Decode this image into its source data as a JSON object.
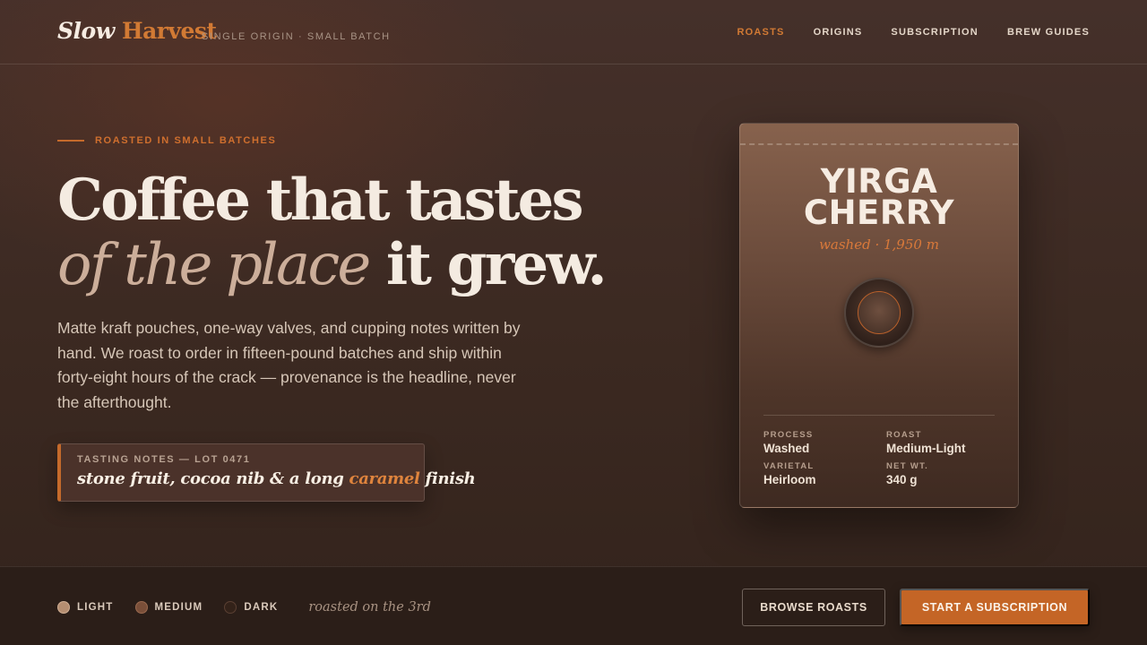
{
  "brand": {
    "word1": "Slow",
    "word2": "Harvest",
    "tagline": "SINGLE ORIGIN · SMALL BATCH"
  },
  "nav": {
    "items": [
      {
        "label": "ROASTS",
        "active": true
      },
      {
        "label": "ORIGINS",
        "active": false
      },
      {
        "label": "SUBSCRIPTION",
        "active": false
      },
      {
        "label": "BREW GUIDES",
        "active": false
      }
    ]
  },
  "hero": {
    "eyebrow": "ROASTED IN SMALL BATCHES",
    "headline": {
      "part1": "Coffee that tastes ",
      "part2_italic": "of the place",
      "part3": " it grew."
    },
    "intro": "Matte kraft pouches, one-way valves, and cupping notes written by hand. We roast to order in fifteen-pound batches and ship within forty-eight hours of the crack — provenance is the headline, never the afterthought.",
    "tasting": {
      "label": "TASTING NOTES — LOT 0471",
      "note_before": "stone fruit, cocoa nib & a long ",
      "note_highlight": "caramel",
      "note_after": " finish"
    }
  },
  "bag": {
    "name_line1": "YIRGA",
    "name_line2": "CHERRY",
    "subtitle": "washed · 1,950 m",
    "specs": [
      {
        "label": "PROCESS",
        "value": "Washed"
      },
      {
        "label": "ROAST",
        "value": "Medium-Light"
      },
      {
        "label": "VARIETAL",
        "value": "Heirloom"
      },
      {
        "label": "NET WT.",
        "value": "340 g"
      }
    ]
  },
  "footer": {
    "roast_levels": [
      {
        "label": "LIGHT",
        "color": "#b58e71"
      },
      {
        "label": "MEDIUM",
        "color": "#7a4f39"
      },
      {
        "label": "DARK",
        "color": "#332219"
      }
    ],
    "roast_date": "roasted on the 3rd",
    "browse_label": "BROWSE ROASTS",
    "subscribe_label": "START A SUBSCRIPTION"
  },
  "colors": {
    "accent": "#c46526",
    "background": "#3b2921",
    "text": "#f1e6da"
  }
}
